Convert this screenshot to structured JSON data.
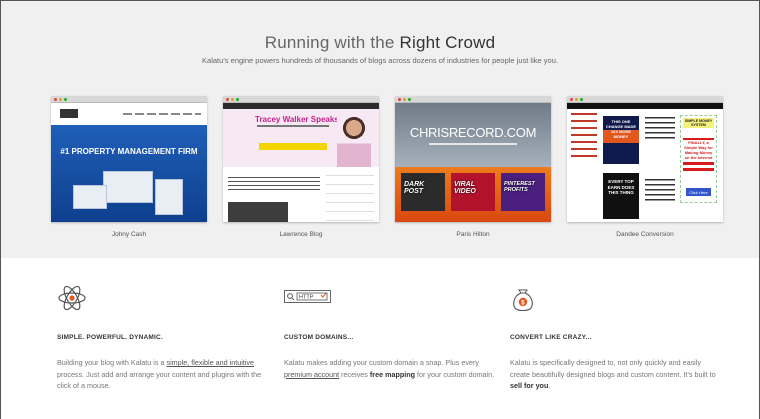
{
  "header": {
    "title_prefix": "Running with the ",
    "title_emphasis": "Right Crowd",
    "subtitle": "Kalatu’s engine powers hundreds of thousands of blogs across dozens of industries for people just like you."
  },
  "showcase": [
    {
      "caption": "Johny Cash",
      "headline": "#1 PROPERTY MANAGEMENT FIRM"
    },
    {
      "caption": "Lawrence Blog",
      "headline": "Tracey Walker Speaks"
    },
    {
      "caption": "Paris Hilton",
      "headline": "CHRISRECORD.COM",
      "boxes": [
        "DARK POST",
        "VIRAL VIDEO",
        "PINTEREST PROFITS"
      ]
    },
    {
      "caption": "Dandee Conversion",
      "box1": "THIS ONE CHANGE MADE 10X MORE MONEY",
      "ad_top": "SIMPLE MONEY SYSTEM",
      "ad_mid": "FINALLY, a Simple Way for Making Money on the Internet",
      "ad_btn": "Click Here",
      "box2": "EVERY TOP EARN DOES THIS THING"
    }
  ],
  "features": [
    {
      "icon": "atom-icon",
      "title": "SIMPLE. POWERFUL. DYNAMIC.",
      "body_pre": "Building your blog with Kalatu is a ",
      "body_link": "simple, flexible and intuitive",
      "body_post": " process. Just add and arrange your content and plugins with the click of a mouse."
    },
    {
      "icon": "domain-search-icon",
      "icon_label": "HTTP",
      "title": "CUSTOM DOMAINS...",
      "body_pre": "Kalatu makes adding your custom domain a snap. Plus every ",
      "body_link": "premium account",
      "body_mid": " receives ",
      "body_bold": "free mapping",
      "body_post": " for your custom domain."
    },
    {
      "icon": "money-bag-icon",
      "title": "CONVERT LIKE CRAZY...",
      "body_pre": "Kalatu is specifically designed to, not only quickly and easily create beautifully designed blogs and custom content. It’s built to ",
      "body_bold": "sell for you",
      "body_post": "."
    }
  ],
  "colors": {
    "accent": "#c1238d",
    "orange": "#e2571e",
    "blue": "#1f5fb8"
  }
}
